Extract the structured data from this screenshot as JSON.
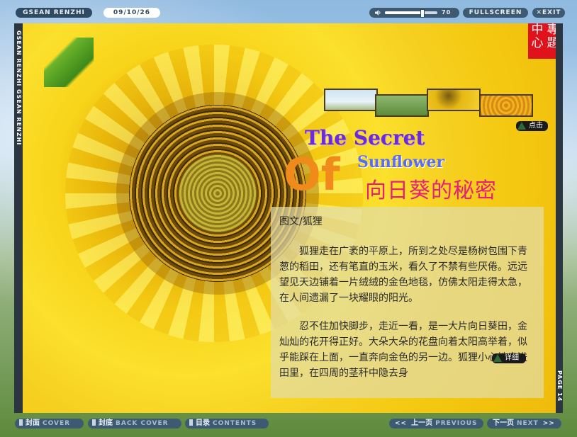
{
  "top_bar": {
    "site_name": "GSEAN RENZHI",
    "date": "09/10/26",
    "volume_value": "70",
    "volume_level_percent": 70,
    "fullscreen_label": "FULLSCREEN",
    "exit_label": "✕EXIT"
  },
  "spine": {
    "text": "GSEAN RENZHI  GSEAN RENZHI",
    "page_label": "PAGE 14"
  },
  "corner_badge": {
    "chars": [
      "中",
      "專",
      "心",
      "題"
    ]
  },
  "thumbnails_tip": "点击",
  "article": {
    "title_line1": "The Secret",
    "title_line2": "Sunflower",
    "title_of": "Of",
    "title_cn": "向日葵的秘密",
    "byline": "图文/狐狸",
    "para1": "狐狸走在广袤的平原上，所到之处尽是杨树包围下青葱的稻田，还有笔直的玉米，看久了不禁有些厌倦。远远望见天边铺着一片绒绒的金色地毯，仿佛太阳走得太急，在人间遗漏了一块耀眼的阳光。",
    "para2": "忍不住加快脚步，走近一看，是一大片向日葵田，金灿灿的花开得正好。大朵大朵的花盘向着太阳高举着，似乎能踩在上面，一直奔向金色的另一边。狐狸小心地走进田里，在四周的茎秆中隐去身",
    "detail_tip": "详细"
  },
  "bottom_nav": {
    "cover_cn": "封面",
    "cover_en": "COVER",
    "back_cover_cn": "封底",
    "back_cover_en": "BACK COVER",
    "contents_cn": "目录",
    "contents_en": "CONTENTS",
    "prev_arrow": "<<",
    "prev_cn": "上一页",
    "prev_en": "PREVIOUS",
    "next_cn": "下一页",
    "next_en": "NEXT",
    "next_arrow": ">>"
  },
  "colors": {
    "bar": "#3e5a73",
    "title_cn": "#e81e7c",
    "of": "#f08a1a",
    "badge": "#e0121c"
  }
}
